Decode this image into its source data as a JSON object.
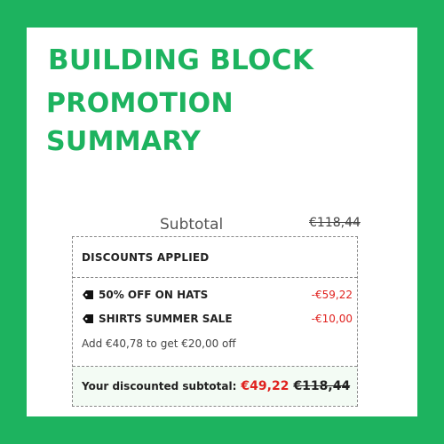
{
  "heading": {
    "line1": "BUILDING BLOCK",
    "line2": "PROMOTION",
    "line3": "SUMMARY"
  },
  "subtotal": {
    "label": "Subtotal",
    "value": "€118,44"
  },
  "discounts": {
    "header": "DISCOUNTS APPLIED",
    "items": [
      {
        "name": "50% OFF ON HATS",
        "amount": "-€59,22",
        "icon": "tag-icon"
      },
      {
        "name": "SHIRTS SUMMER SALE",
        "amount": "-€10,00",
        "icon": "tag-icon"
      }
    ],
    "hint": "Add €40,78 to get €20,00 off"
  },
  "footer": {
    "label": "Your discounted subtotal:",
    "new_total": "€49,22",
    "old_total": "€118,44"
  },
  "colors": {
    "background": "#1db35f",
    "accent_green": "#1db35f",
    "discount_red": "#e0221f"
  }
}
